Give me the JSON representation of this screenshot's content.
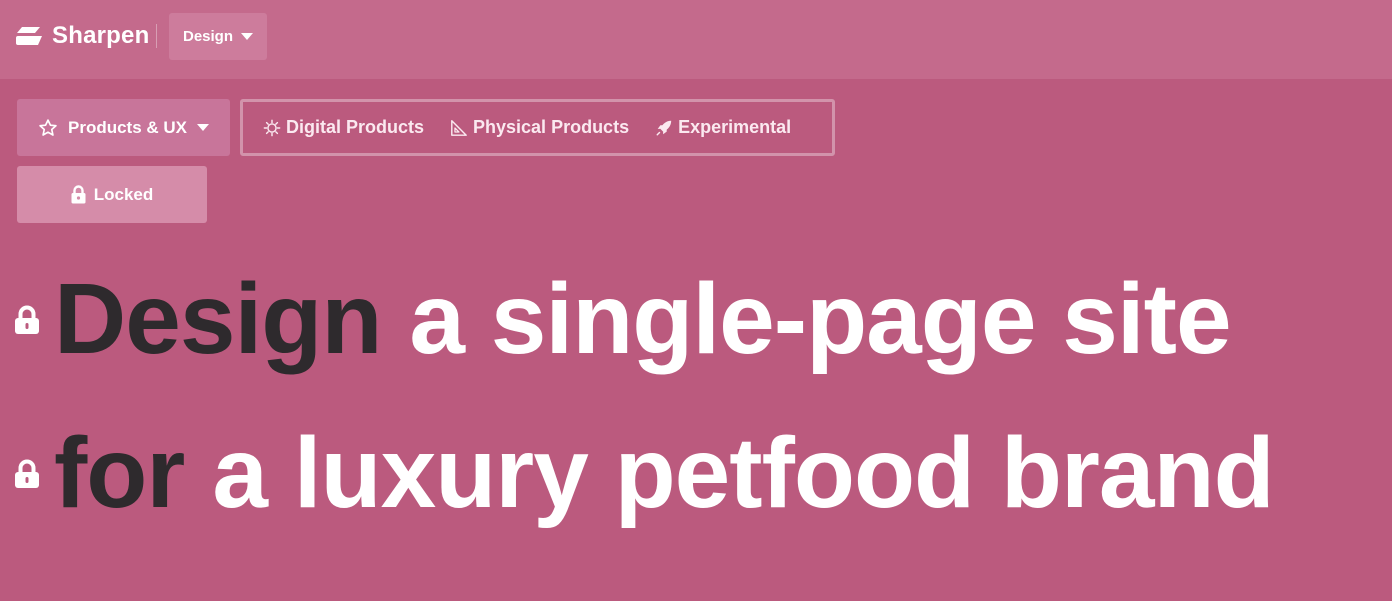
{
  "header": {
    "brand": "Sharpen",
    "mode_dropdown": "Design"
  },
  "category": {
    "label": "Products & UX",
    "icon": "star-icon"
  },
  "subcategories": [
    {
      "label": "Digital Products",
      "icon": "sun-gear-icon"
    },
    {
      "label": "Physical Products",
      "icon": "set-square-icon"
    },
    {
      "label": "Experimental",
      "icon": "rocket-icon"
    }
  ],
  "locked_button": {
    "label": "Locked",
    "icon": "lock-icon"
  },
  "prompt": {
    "line1": {
      "locked_word": "Design",
      "text": "a single-page site"
    },
    "line2": {
      "locked_word": "for",
      "text": "a luxury petfood brand"
    }
  },
  "colors": {
    "background": "#bb5a7e",
    "topbar": "#c46a8c",
    "locked_word": "#2e2a2d",
    "text": "#ffffff"
  }
}
